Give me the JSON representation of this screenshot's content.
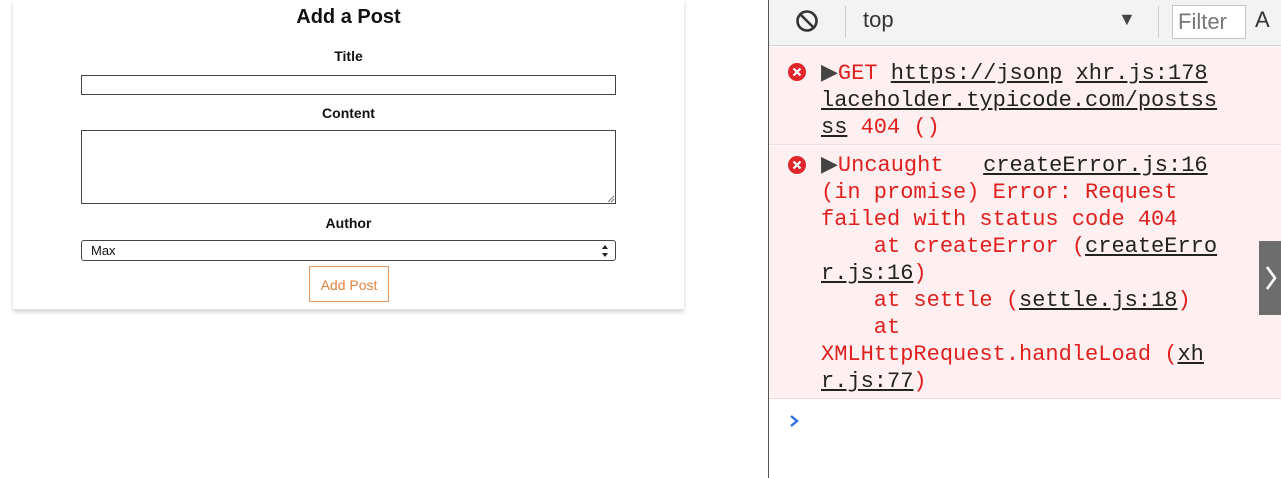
{
  "app": {
    "title": "Add a Post",
    "title_label": "Title",
    "content_label": "Content",
    "author_label": "Author",
    "title_value": "",
    "content_value": "",
    "author_selected": "Max",
    "add_button": "Add Post"
  },
  "devtools": {
    "context": "top",
    "filter_placeholder": "Filter",
    "after_filter": "A",
    "messages": [
      {
        "line1_prefix": "GET ",
        "line1_url": "https://jsonp",
        "line1_source": "xhr.js:178",
        "line2": "laceholder.typicode.com/postss",
        "line3_link": "ss",
        "line3_rest": " 404 ()"
      },
      {
        "line1_text": "Uncaught",
        "line1_source": "createError.js:16",
        "line2": "(in promise) Error: Request",
        "line3": "failed with status code 404",
        "line4_text": "    at createError (",
        "line4_link": "createErro",
        "line5_link": "r.js:16",
        "line5_end": ")",
        "line6_text": "    at settle (",
        "line6_link": "settle.js:18",
        "line6_end": ")",
        "line7": "    at",
        "line8_text": "XMLHttpRequest.handleLoad (",
        "line8_link": "xh",
        "line9_link": "r.js:77",
        "line9_end": ")"
      }
    ]
  },
  "colors": {
    "error_text": "#e01f1f",
    "error_bg": "#fef0f0",
    "button_accent": "#e4823d"
  }
}
